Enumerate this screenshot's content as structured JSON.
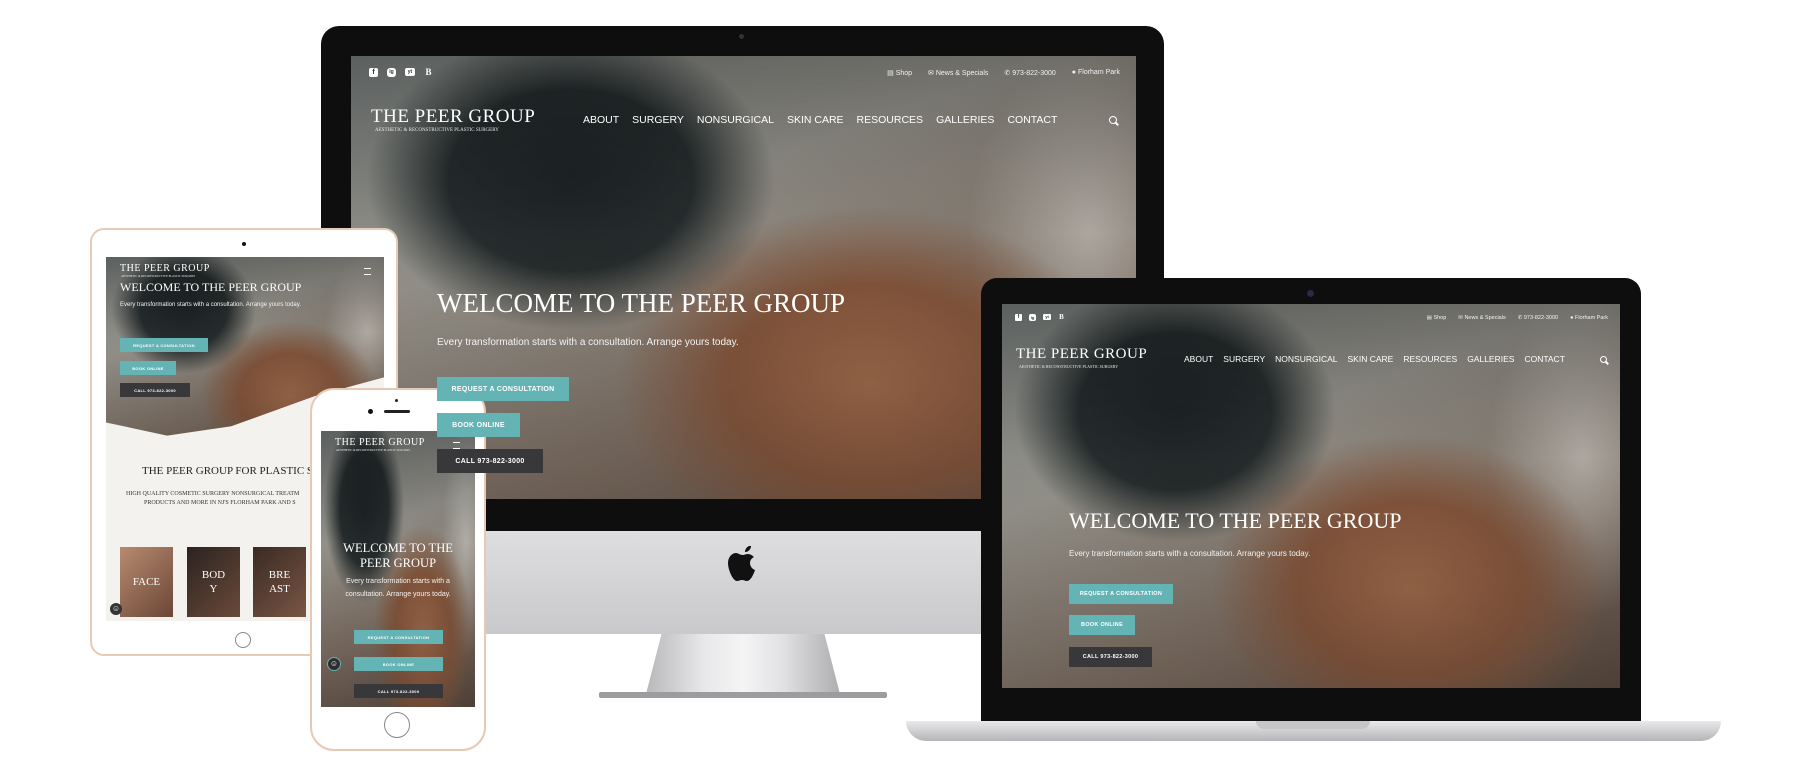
{
  "brand": {
    "name": "THE PEER GROUP",
    "tagline": "AESTHETIC & RECONSTRUCTIVE PLASTIC SURGERY"
  },
  "topbar": {
    "shop": "Shop",
    "news": "News & Specials",
    "phone": "973-822-3000",
    "location": "Florham Park"
  },
  "social": [
    "f",
    "ig",
    "yt",
    "B"
  ],
  "nav": [
    "ABOUT",
    "SURGERY",
    "NONSURGICAL",
    "SKIN CARE",
    "RESOURCES",
    "GALLERIES",
    "CONTACT"
  ],
  "hero": {
    "title": "WELCOME TO THE PEER GROUP",
    "subtitle": "Every transformation starts with a consultation. Arrange yours today.",
    "btn_consult": "REQUEST A CONSULTATION",
    "btn_book": "BOOK ONLINE",
    "btn_call": "CALL 973-822-3000"
  },
  "tablet": {
    "intro_title": "THE PEER GROUP FOR PLASTIC SU",
    "intro_text_1": "HIGH QUALITY COSMETIC SURGERY NONSURGICAL TREATM",
    "intro_text_2": "PRODUCTS AND MORE IN NJ'S FLORHAM PARK AND S",
    "cards": [
      "FACE",
      "BOD Y",
      "BRE AST"
    ]
  },
  "phone": {
    "title_line1": "WELCOME TO THE",
    "title_line2": "PEER GROUP",
    "sub_line1": "Every transformation starts with a",
    "sub_line2": "consultation. Arrange yours today."
  },
  "colors": {
    "teal": "#64b3b5",
    "dark_button": "#38383a",
    "bezel": "#111111"
  },
  "icons": [
    "facebook-icon",
    "instagram-icon",
    "youtube-icon",
    "blog-icon",
    "cart-icon",
    "mail-icon",
    "phone-icon",
    "location-pin-icon",
    "search-icon",
    "hamburger-menu-icon",
    "apple-logo-icon",
    "accessibility-icon"
  ]
}
